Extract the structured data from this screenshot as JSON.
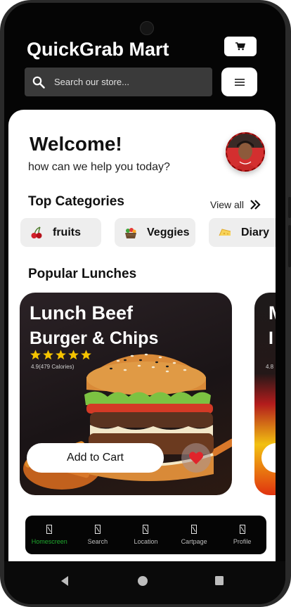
{
  "header": {
    "app_title": "QuickGrab Mart",
    "search_placeholder": "Search our store..."
  },
  "welcome": {
    "title": "Welcome!",
    "subtitle": "how can we help you today?"
  },
  "categories": {
    "title": "Top Categories",
    "view_all": "View all",
    "items": [
      {
        "label": "fruits",
        "icon": "cherry-icon"
      },
      {
        "label": "Veggies",
        "icon": "veggies-basket-icon"
      },
      {
        "label": "Diary",
        "icon": "cheese-icon"
      }
    ]
  },
  "lunches": {
    "title": "Popular Lunches",
    "cards": [
      {
        "title": "Lunch Beef",
        "subtitle": "Burger & Chips",
        "stars": 5,
        "rating_text": "4.9(479 Calories)",
        "add_to_cart": "Add to Cart"
      },
      {
        "title": "M",
        "subtitle": "I",
        "rating_text": "4.8"
      }
    ]
  },
  "bottom_nav": [
    {
      "label": "Homescreen",
      "active": true
    },
    {
      "label": "Search",
      "active": false
    },
    {
      "label": "Location",
      "active": false
    },
    {
      "label": "Cartpage",
      "active": false
    },
    {
      "label": "Profile",
      "active": false
    }
  ],
  "colors": {
    "accent_active": "#1faa2e",
    "star": "#f6c400",
    "heart": "#e0242b"
  }
}
